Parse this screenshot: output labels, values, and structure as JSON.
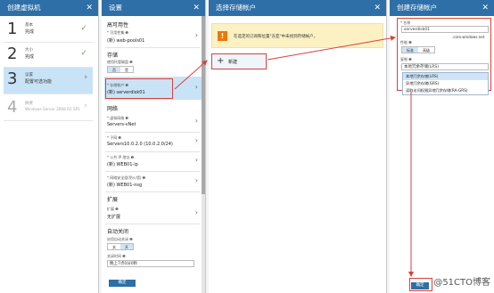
{
  "blades": {
    "create_vm": {
      "title": "创建虚拟机",
      "steps": [
        {
          "num": "1",
          "line1": "基本",
          "line2": "完成"
        },
        {
          "num": "2",
          "line1": "大小",
          "line2": "完成"
        },
        {
          "num": "3",
          "line1": "设置",
          "line2": "配置可选功能"
        },
        {
          "num": "4",
          "line1": "摘要",
          "line2": "Windows Server 2008 R2 SP1"
        }
      ]
    },
    "settings": {
      "title": "设置",
      "high_availability": "高可用性",
      "availability_set_label": "* 可用性集 ❶",
      "availability_set_value": "(新) web-pools01",
      "storage": "存储",
      "managed_disks_label": "使用托管磁盘 ❶",
      "no": "否",
      "yes": "是",
      "storage_account_label": "* 存储帐户 ❶",
      "storage_account_value": "(新) serverdisk01",
      "network": "网络",
      "vnet_label": "* 虚拟网络 ❶",
      "vnet_value": "Servers-vNet",
      "subnet_label": "* 子网 ❶",
      "subnet_value": "Servers10.0.2.0 (10.0.2.0/24)",
      "public_ip_label": "* 公共 IP 地址 ❶",
      "public_ip_value": "(新) WEB01-ip",
      "nsg_label": "* 网络安全组(防火墙) ❶",
      "nsg_value": "(新) WEB01-nsg",
      "extensions": "扩展",
      "extensions_label": "扩展 ❶",
      "extensions_value": "无扩展",
      "auto_shutdown": "自动关闭",
      "auto_shutdown_label": "启用自动关闭 ❶",
      "off": "关",
      "on": "开",
      "shutdown_time_label": "关闭时间 ❶",
      "shutdown_time_value": "晚上7点0分0秒",
      "ok": "确定"
    },
    "choose_storage": {
      "title": "选择存储帐户",
      "warning": "在选定的订阅和位置\"东亚\"中未找到存储帐户。",
      "new": "新建"
    },
    "create_storage": {
      "title": "创建存储帐户",
      "name_label": "* 名称",
      "name_value": "serverdisk01",
      "domain_suffix": ".core.windows.net",
      "performance_label": "性能 ❶",
      "standard": "标准",
      "premium": "高级",
      "replication_label": "复制 ❶",
      "replication_value": "本地冗余存储(LRS)",
      "replication_options": [
        "本地冗余存储(LRS)",
        "异地冗余存储(GRS)",
        "读取访问权限异地冗余存储(RA-GRS)"
      ],
      "ok": "确定"
    }
  },
  "watermark": "@51CTO博客",
  "colors": {
    "header": "#2e6fa7",
    "highlight": "#d9413a",
    "selected": "#c9e3f6"
  }
}
